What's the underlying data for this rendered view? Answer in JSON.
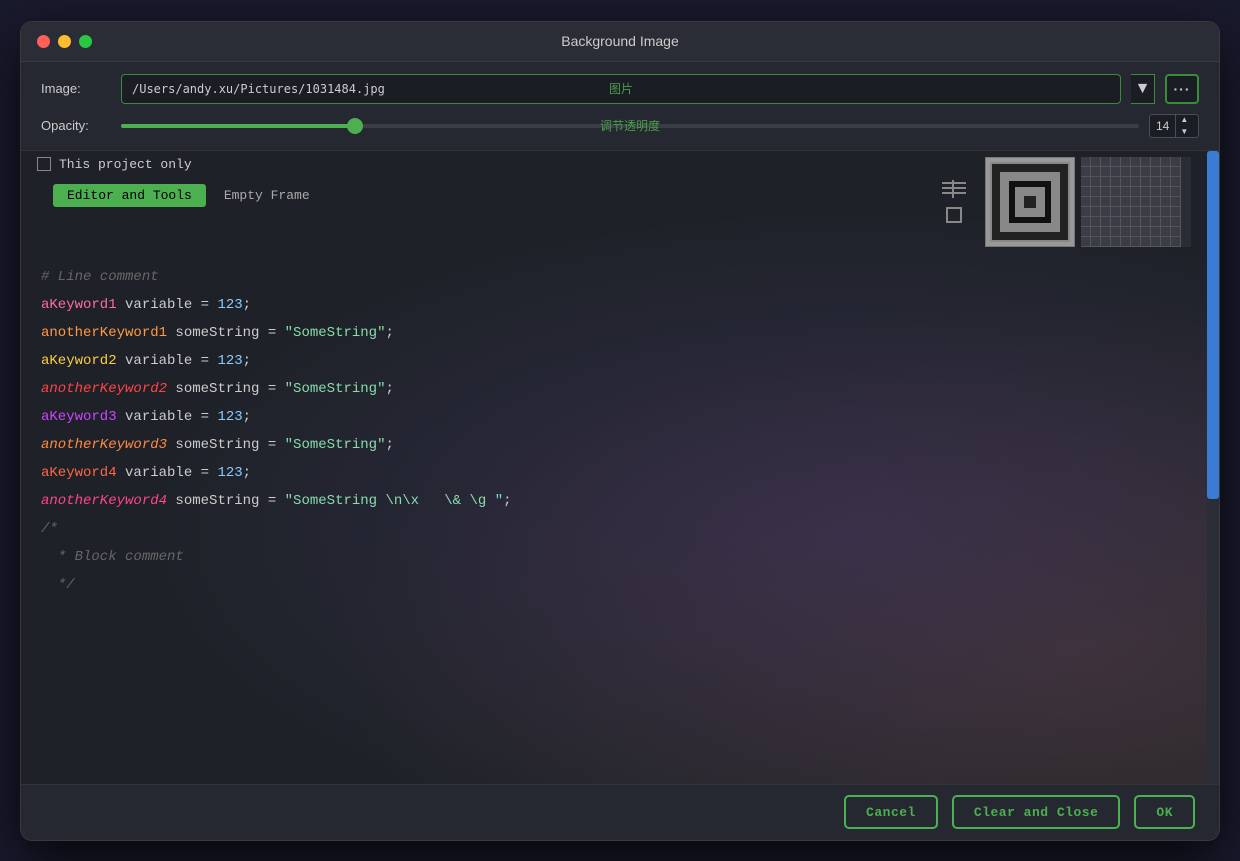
{
  "window": {
    "title": "Background Image"
  },
  "image_row": {
    "label": "Image:",
    "path": "/Users/andy.xu/Pictures/1031484.jpg",
    "hint": "图片"
  },
  "opacity_row": {
    "label": "Opacity:",
    "hint": "调节透明度",
    "value": "14"
  },
  "options": {
    "checkbox_label": "This project only"
  },
  "tabs": [
    {
      "label": "Editor and Tools",
      "active": true
    },
    {
      "label": "Empty Frame",
      "active": false
    }
  ],
  "footer": {
    "cancel_label": "Cancel",
    "clear_close_label": "Clear and Close",
    "ok_label": "OK"
  },
  "code_lines": [
    {
      "id": 1,
      "type": "comment",
      "text": "# Line comment"
    },
    {
      "id": 2,
      "type": "code",
      "parts": [
        {
          "t": "keyword1",
          "v": "aKeyword1"
        },
        {
          "t": "white",
          "v": " variable = "
        },
        {
          "t": "number",
          "v": "123"
        },
        {
          "t": "punct",
          "v": ";"
        }
      ]
    },
    {
      "id": 3,
      "type": "code",
      "parts": [
        {
          "t": "keyword2",
          "v": "anotherKeyword1"
        },
        {
          "t": "white",
          "v": " someString = "
        },
        {
          "t": "string",
          "v": "\"SomeString\""
        },
        {
          "t": "punct",
          "v": ";"
        }
      ]
    },
    {
      "id": 4,
      "type": "code",
      "parts": [
        {
          "t": "keyword3",
          "v": "aKeyword2"
        },
        {
          "t": "white",
          "v": " variable = "
        },
        {
          "t": "number",
          "v": "123"
        },
        {
          "t": "punct",
          "v": ";"
        }
      ]
    },
    {
      "id": 5,
      "type": "code",
      "parts": [
        {
          "t": "keyword4",
          "v": "anotherKeyword2"
        },
        {
          "t": "white",
          "v": " someString = "
        },
        {
          "t": "string",
          "v": "\"SomeString\""
        },
        {
          "t": "punct",
          "v": ";"
        }
      ]
    },
    {
      "id": 6,
      "type": "code",
      "parts": [
        {
          "t": "keyword5",
          "v": "aKeyword3"
        },
        {
          "t": "white",
          "v": " variable = "
        },
        {
          "t": "number",
          "v": "123"
        },
        {
          "t": "punct",
          "v": ";"
        }
      ]
    },
    {
      "id": 7,
      "type": "code",
      "parts": [
        {
          "t": "keyword6",
          "v": "anotherKeyword3"
        },
        {
          "t": "white",
          "v": " someString = "
        },
        {
          "t": "string",
          "v": "\"SomeString\""
        },
        {
          "t": "punct",
          "v": ";"
        }
      ]
    },
    {
      "id": 8,
      "type": "code",
      "parts": [
        {
          "t": "keyword7",
          "v": "aKeyword4"
        },
        {
          "t": "white",
          "v": " variable = "
        },
        {
          "t": "number",
          "v": "123"
        },
        {
          "t": "punct",
          "v": ";"
        }
      ]
    },
    {
      "id": 9,
      "type": "code",
      "parts": [
        {
          "t": "keyword8",
          "v": "anotherKeyword4"
        },
        {
          "t": "white",
          "v": " someString = "
        },
        {
          "t": "string",
          "v": "\"SomeString \\n\\x   \\& \\g \""
        },
        {
          "t": "punct",
          "v": ";"
        }
      ]
    },
    {
      "id": 10,
      "type": "comment",
      "text": "/*"
    },
    {
      "id": 11,
      "type": "comment",
      "text": "  * Block comment"
    },
    {
      "id": 12,
      "type": "comment",
      "text": "  */"
    }
  ]
}
